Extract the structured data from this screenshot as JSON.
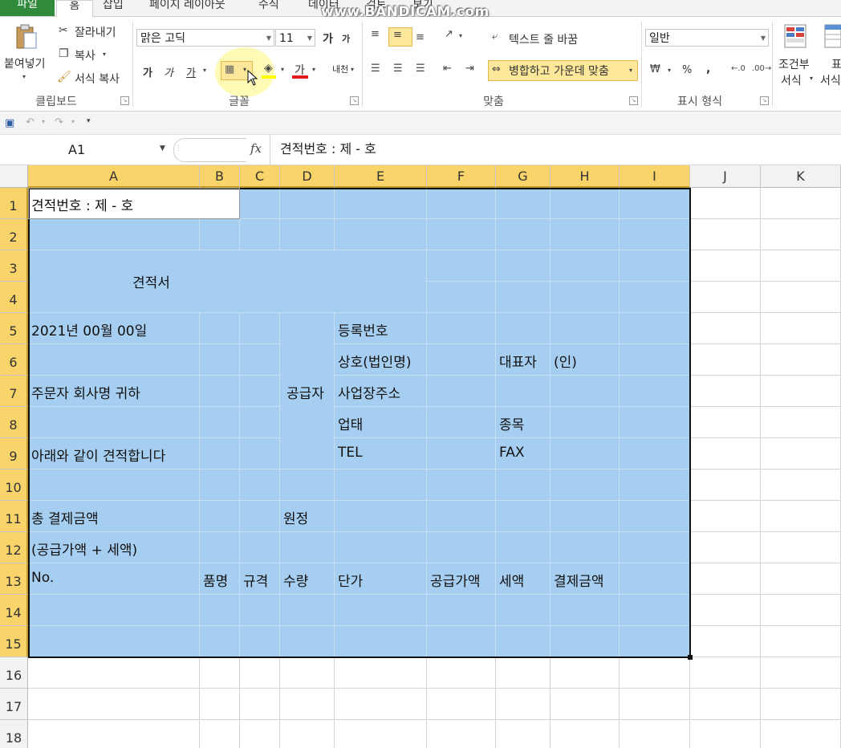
{
  "watermark": "www.BANDICAM.com",
  "tabs": [
    "파일",
    "홈",
    "삽입",
    "페이지 레이아웃",
    "수식",
    "데이터",
    "검토",
    "보기"
  ],
  "clipboard": {
    "paste": "붙여넣기",
    "cut": "잘라내기",
    "copy": "복사",
    "format_painter": "서식 복사",
    "label": "클립보드"
  },
  "font": {
    "name": "맑은 고딕",
    "size": "11",
    "label": "글꼴",
    "bold": "가",
    "italic": "가",
    "underline": "가",
    "grow": "가",
    "shrink": "가",
    "font_color": "가",
    "phonetic": "내천",
    "highlight_color": "#ffff00",
    "font_color_bar": "#e11b1b"
  },
  "alignment": {
    "wrap_text": "텍스트 줄 바꿈",
    "merge_center": "병합하고 가운데 맞춤",
    "label": "맞춤"
  },
  "number": {
    "format": "일반",
    "label": "표시 형식",
    "percent": "%",
    "comma": ","
  },
  "styles": {
    "conditional_1": "조건부",
    "conditional_2": "서식",
    "table_1": "표",
    "table_2": "서식"
  },
  "formula_bar": {
    "name_box": "A1",
    "fx": "fx",
    "content": "견적번호 : 제  -  호"
  },
  "columns": [
    "A",
    "B",
    "C",
    "D",
    "E",
    "F",
    "G",
    "H",
    "I",
    "J",
    "K"
  ],
  "rows": [
    "1",
    "2",
    "3",
    "4",
    "5",
    "6",
    "7",
    "8",
    "9",
    "10",
    "11",
    "12",
    "13",
    "14",
    "15",
    "16",
    "17",
    "18"
  ],
  "cells": {
    "A1": "견적번호 : 제  -  호",
    "A3": "견적서",
    "A5": "2021년    00월    00일",
    "A7": "주문자 회사명     귀하",
    "A9": "아래와 같이 견적합니다",
    "A11": "총 결제금액",
    "A12": "(공급가액 + 세액)",
    "A13": "No.",
    "B13": "품명",
    "C13": "규격",
    "D13": "수량",
    "D7": "공급자",
    "D11": "원정",
    "E5": "등록번호",
    "E6": "상호(법인명)",
    "E7": "사업장주소",
    "E8": "업태",
    "E9": "TEL",
    "E13": "단가",
    "F13": "공급가액",
    "G6": "대표자",
    "G8": "종목",
    "G9": "FAX",
    "G13": "세액",
    "H6": "(인)",
    "H13": "결제금액"
  },
  "colors": {
    "selection_fill": "#a6cef0",
    "header_selected": "#f9d46a",
    "file_tab": "#2f8a3c"
  }
}
